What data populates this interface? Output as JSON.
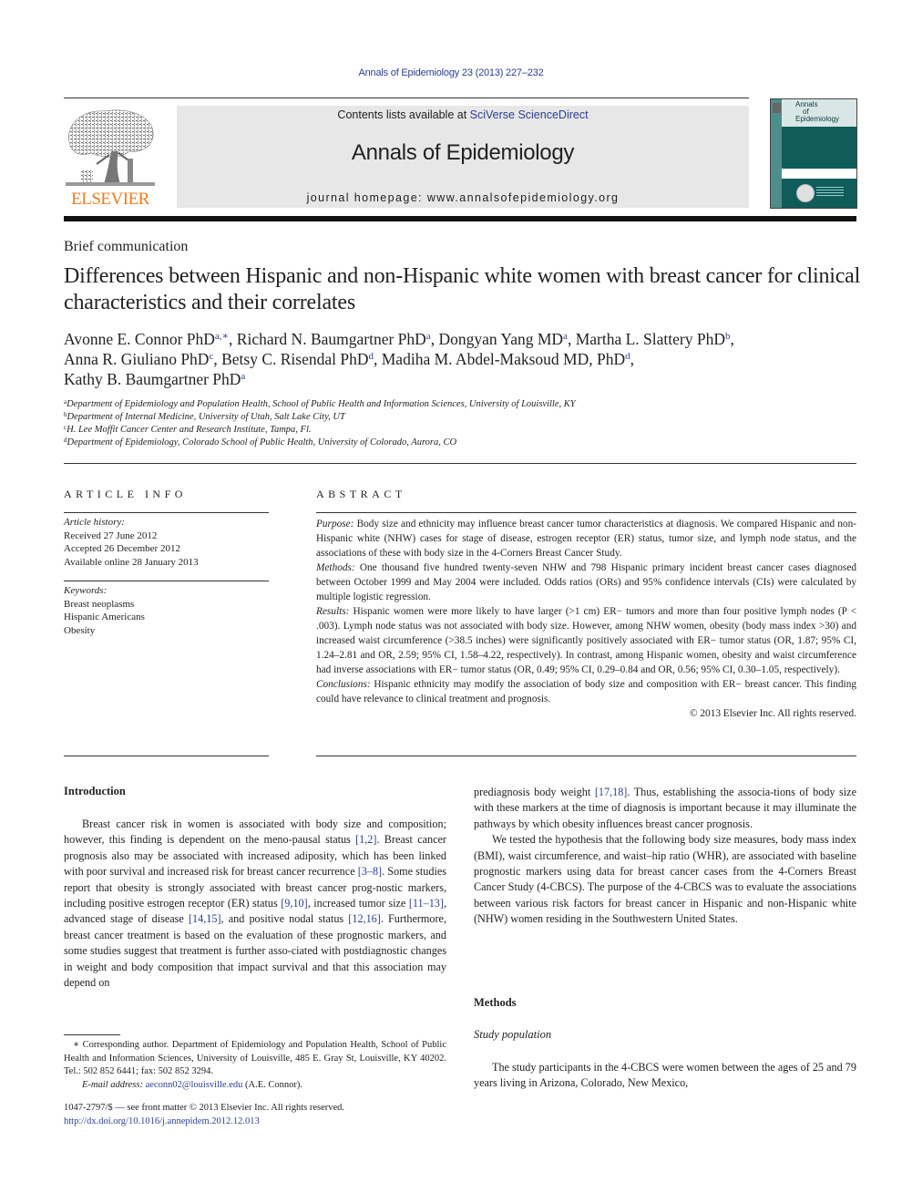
{
  "journal_ref": "Annals of Epidemiology 23 (2013) 227–232",
  "header": {
    "publisher_logo_text": "ELSEVIER",
    "contents_prefix": "Contents lists available at ",
    "contents_link": "SciVerse ScienceDirect",
    "journal_title": "Annals of Epidemiology",
    "homepage_prefix": "journal homepage: ",
    "homepage_url": "www.annalsofepidemiology.org",
    "cover_title_lines": [
      "Annals",
      "of",
      "Epidemiology"
    ]
  },
  "article": {
    "type": "Brief communication",
    "title": "Differences between Hispanic and non-Hispanic white women with breast cancer for clinical characteristics and their correlates",
    "authors": [
      {
        "name": "Avonne E. Connor PhD",
        "sup": "a,∗",
        "sep": ", "
      },
      {
        "name": "Richard N. Baumgartner PhD",
        "sup": "a",
        "sep": ", "
      },
      {
        "name": "Dongyan Yang MD",
        "sup": "a",
        "sep": ", "
      },
      {
        "name": "Martha L. Slattery PhD",
        "sup": "b",
        "sep": ","
      },
      {
        "name": "Anna R. Giuliano PhD",
        "sup": "c",
        "sep": ", "
      },
      {
        "name": "Betsy C. Risendal PhD",
        "sup": "d",
        "sep": ", "
      },
      {
        "name": "Madiha M. Abdel-Maksoud MD, PhD",
        "sup": "d",
        "sep": ","
      },
      {
        "name": "Kathy B. Baumgartner PhD",
        "sup": "a",
        "sep": ""
      }
    ],
    "affiliations": [
      {
        "key": "a",
        "text": "Department of Epidemiology and Population Health, School of Public Health and Information Sciences, University of Louisville, KY"
      },
      {
        "key": "b",
        "text": "Department of Internal Medicine, University of Utah, Salt Lake City, UT"
      },
      {
        "key": "c",
        "text": "H. Lee Moffit Cancer Center and Research Institute, Tampa, Fl."
      },
      {
        "key": "d",
        "text": "Department of Epidemiology, Colorado School of Public Health, University of Colorado, Aurora, CO"
      }
    ]
  },
  "article_info": {
    "heading": "ARTICLE INFO",
    "history_label": "Article history:",
    "history": [
      "Received 27 June 2012",
      "Accepted 26 December 2012",
      "Available online 28 January 2013"
    ],
    "keywords_label": "Keywords:",
    "keywords": [
      "Breast neoplasms",
      "Hispanic Americans",
      "Obesity"
    ]
  },
  "abstract": {
    "heading": "ABSTRACT",
    "purpose_label": "Purpose:",
    "purpose": " Body size and ethnicity may influence breast cancer tumor characteristics at diagnosis. We compared Hispanic and non-Hispanic white (NHW) cases for stage of disease, estrogen receptor (ER) status, tumor size, and lymph node status, and the associations of these with body size in the 4-Corners Breast Cancer Study.",
    "methods_label": "Methods:",
    "methods": " One thousand five hundred twenty-seven NHW and 798 Hispanic primary incident breast cancer cases diagnosed between October 1999 and May 2004 were included. Odds ratios (ORs) and 95% confidence intervals (CIs) were calculated by multiple logistic regression.",
    "results_label": "Results:",
    "results": " Hispanic women were more likely to have larger (>1 cm) ER− tumors and more than four positive lymph nodes (P < .003). Lymph node status was not associated with body size. However, among NHW women, obesity (body mass index >30) and increased waist circumference (>38.5 inches) were significantly positively associated with ER− tumor status (OR, 1.87; 95% CI, 1.24–2.81 and OR, 2.59; 95% CI, 1.58–4.22, respectively). In contrast, among Hispanic women, obesity and waist circumference had inverse associations with ER− tumor status (OR, 0.49; 95% CI, 0.29–0.84 and OR, 0.56; 95% CI, 0.30–1.05, respectively).",
    "conclusions_label": "Conclusions:",
    "conclusions": " Hispanic ethnicity may modify the association of body size and composition with ER− breast cancer. This finding could have relevance to clinical treatment and prognosis.",
    "copyright": "© 2013 Elsevier Inc. All rights reserved."
  },
  "introduction": {
    "heading": "Introduction",
    "p1": [
      {
        "t": "Breast cancer risk in women is associated with body size and composition; however, this finding is dependent on the meno-pausal status "
      },
      {
        "r": "[1,2]"
      },
      {
        "t": ". Breast cancer prognosis also may be associated with increased adiposity, which has been linked with poor survival and increased risk for breast cancer recurrence "
      },
      {
        "r": "[3–8]"
      },
      {
        "t": ". Some studies report that obesity is strongly associated with breast cancer prog-nostic markers, including positive estrogen receptor (ER) status "
      },
      {
        "r": "[9,10]"
      },
      {
        "t": ", increased tumor size "
      },
      {
        "r": "[11–13]"
      },
      {
        "t": ", advanced stage of disease "
      },
      {
        "r": "[14,15]"
      },
      {
        "t": ", and positive nodal status "
      },
      {
        "r": "[12,16]"
      },
      {
        "t": ". Furthermore, breast cancer treatment is based on the evaluation of these prognostic markers, and some studies suggest that treatment is further asso-ciated with postdiagnostic changes in weight and body composition that impact survival and that this association may depend on"
      }
    ],
    "p1_cont": [
      {
        "t": "prediagnosis body weight "
      },
      {
        "r": "[17,18]"
      },
      {
        "t": ". Thus, establishing the associa-tions of body size with these markers at the time of diagnosis is important because it may illuminate the pathways by which obesity influences breast cancer prognosis."
      }
    ],
    "p2": "We tested the hypothesis that the following body size measures, body mass index (BMI), waist circumference, and waist–hip ratio (WHR), are associated with baseline prognostic markers using data for breast cancer cases from the 4-Corners Breast Cancer Study (4-CBCS). The purpose of the 4-CBCS was to evaluate the associations between various risk factors for breast cancer in Hispanic and non-Hispanic white (NHW) women residing in the Southwestern United States."
  },
  "methods": {
    "heading": "Methods",
    "subheading": "Study population",
    "p1": "The study participants in the 4-CBCS were women between the ages of 25 and 79 years living in Arizona, Colorado, New Mexico,"
  },
  "footnote": {
    "corresponding": "∗ Corresponding author. Department of Epidemiology and Population Health, School of Public Health and Information Sciences, University of Louisville, 485 E. Gray St, Louisville, KY 40202. Tel.: 502 852 6441; fax: 502 852 3294.",
    "email_label": "E-mail address: ",
    "email": "aeconn02@louisville.edu",
    "email_suffix": " (A.E. Connor).",
    "front_matter": "1047-2797/$ — see front matter © 2013 Elsevier Inc. All rights reserved.",
    "doi": "http://dx.doi.org/10.1016/j.annepidem.2012.12.013"
  },
  "colors": {
    "link": "#2c3f91",
    "elsevier_orange": "#f07b1d",
    "banner_bg": "#e7e7e7",
    "cover_teal": "#0f5c5b"
  }
}
